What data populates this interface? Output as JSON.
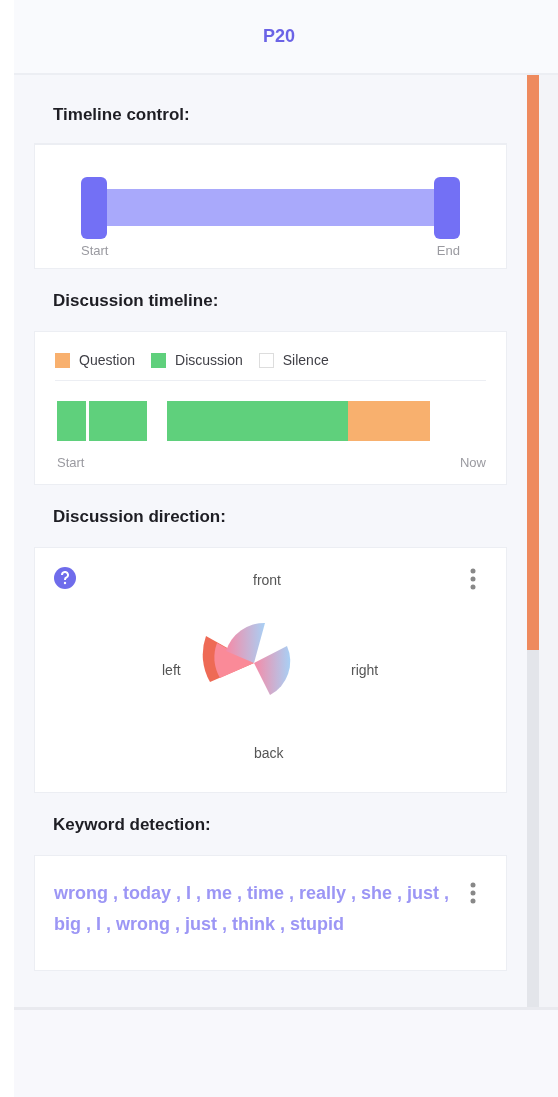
{
  "header": {
    "title": "P20"
  },
  "timeline_control": {
    "heading": "Timeline control:",
    "handles": [
      {
        "label": "Start"
      },
      {
        "label": "End"
      }
    ]
  },
  "discussion_timeline": {
    "heading": "Discussion timeline:",
    "legend": [
      {
        "label": "Question",
        "color": "#f8b06e"
      },
      {
        "label": "Discussion",
        "color": "#5fd07c"
      },
      {
        "label": "Silence",
        "color": "#ffffff"
      }
    ],
    "start_label": "Start",
    "end_label": "Now"
  },
  "discussion_direction": {
    "heading": "Discussion direction:",
    "labels": {
      "front": "front",
      "left": "left",
      "right": "right",
      "back": "back"
    }
  },
  "keyword_detection": {
    "heading": "Keyword detection:",
    "keywords": "wrong , today , I , me , time , really , she , just , big , I , wrong , just , think , stupid"
  }
}
